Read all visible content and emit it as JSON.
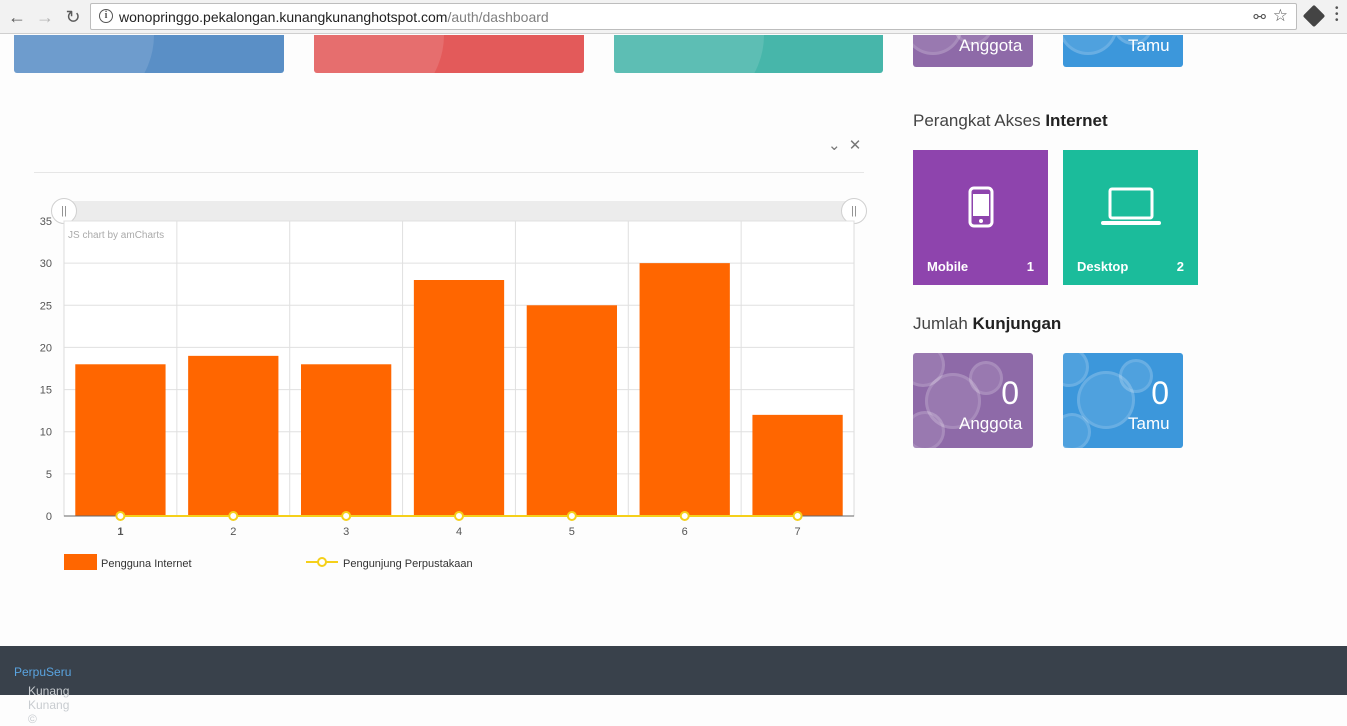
{
  "browser": {
    "url_host": "wonopringgo.pekalongan.kunangkunanghotspot.com",
    "url_path": "/auth/dashboard",
    "back_icon": "arrow-left-icon",
    "forward_icon": "arrow-right-icon",
    "reload_icon": "reload-icon"
  },
  "top_cards": {
    "mini_anggota_label": "Anggota",
    "mini_tamu_label": "Tamu"
  },
  "chart_data": {
    "type": "bar",
    "credit": "JS chart by amCharts",
    "categories": [
      "1",
      "2",
      "3",
      "4",
      "5",
      "6",
      "7"
    ],
    "ylim": [
      0,
      35
    ],
    "y_ticks": [
      "0",
      "5",
      "10",
      "15",
      "20",
      "25",
      "30",
      "35"
    ],
    "grid": true,
    "legend_position": "bottom",
    "series": [
      {
        "name": "Pengguna Internet",
        "kind": "bar",
        "color": "#ff6600",
        "values": [
          18,
          19,
          18,
          28,
          25,
          30,
          12
        ]
      },
      {
        "name": "Pengunjung Perpustakaan",
        "kind": "line",
        "color": "#f5d01a",
        "values": [
          0,
          0,
          0,
          0,
          0,
          0,
          0
        ]
      }
    ]
  },
  "devices": {
    "title_prefix": "Perangkat Akses ",
    "title_bold": "Internet",
    "mobile": {
      "label": "Mobile",
      "count": "1",
      "color": "#8e44ad",
      "icon": "smartphone-icon"
    },
    "desktop": {
      "label": "Desktop",
      "count": "2",
      "color": "#1bbc9b",
      "icon": "laptop-icon"
    }
  },
  "visits": {
    "title_prefix": "Jumlah ",
    "title_bold": "Kunjungan",
    "anggota": {
      "count": "0",
      "label": "Anggota"
    },
    "tamu": {
      "count": "0",
      "label": "Tamu"
    }
  },
  "footer": {
    "text": "Kunang Kunang © ",
    "link": "PerpuSeru"
  }
}
